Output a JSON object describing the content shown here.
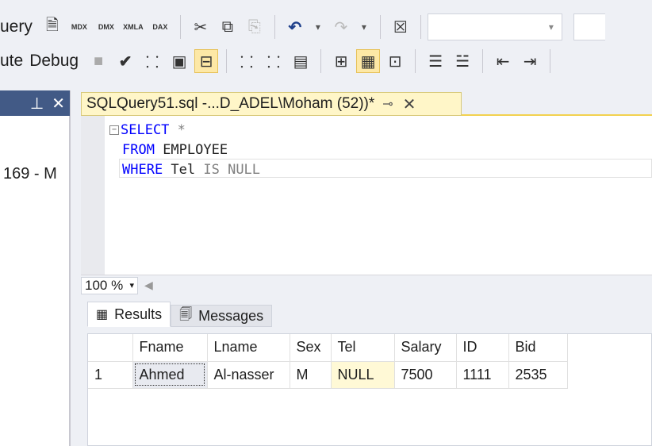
{
  "toolbar1": {
    "menu_fragment": "uery",
    "mdx_label": "MDX",
    "dmx_label": "DMX",
    "xmla_label": "XMLA",
    "dax_label": "DAX"
  },
  "toolbar2": {
    "execute_fragment": "ute",
    "debug_label": "Debug"
  },
  "left_dock": {
    "pin_icon": "pin-icon",
    "close_icon": "close-icon",
    "item_fragment": "169 - M"
  },
  "document_tab": {
    "title": "SQLQuery51.sql -...D_ADEL\\Moham (52))*",
    "pin": "⊸",
    "close": "✕"
  },
  "editor": {
    "line1": {
      "keyword": "SELECT",
      "rest": " *"
    },
    "line2": {
      "keyword": "FROM",
      "rest": " EMPLOYEE"
    },
    "line3": {
      "keyword": "WHERE",
      "col": " Tel",
      "rest": " IS NULL"
    }
  },
  "zoom": {
    "value": "100 %"
  },
  "results_tabs": {
    "results_label": "Results",
    "messages_label": "Messages"
  },
  "grid": {
    "columns": [
      "Fname",
      "Lname",
      "Sex",
      "Tel",
      "Salary",
      "ID",
      "Bid"
    ],
    "rows": [
      {
        "num": "1",
        "cells": [
          "Ahmed",
          "Al-nasser",
          "M",
          "NULL",
          "7500",
          "1111",
          "2535"
        ]
      }
    ]
  },
  "colors": {
    "tab_active_bg": "#fff6c8",
    "dock_header_bg": "#425a86",
    "sql_keyword": "#0000ff",
    "sql_operator": "#808080",
    "null_cell_bg": "#fff9d6"
  }
}
